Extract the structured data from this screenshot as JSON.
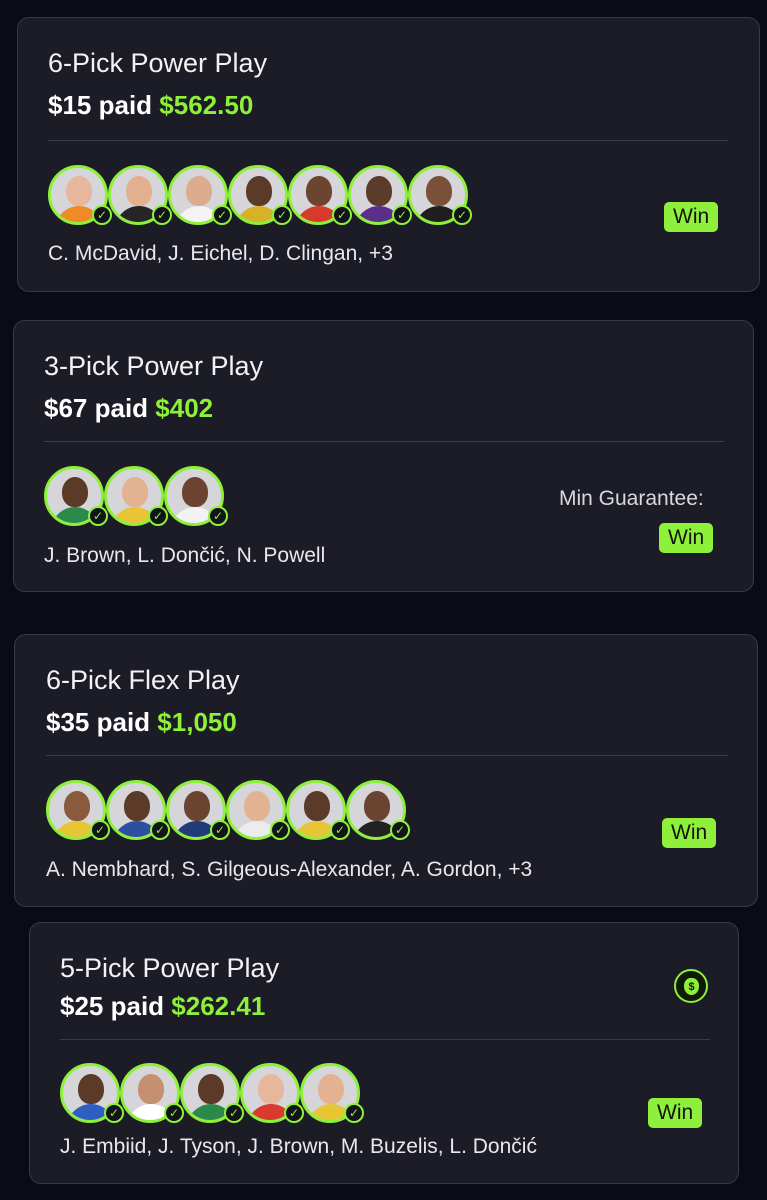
{
  "cards": [
    {
      "title": "6-Pick Power Play",
      "paid": "$15 paid",
      "payout": "$562.50",
      "names": "C. McDavid, J. Eichel, D. Clingan, +3",
      "status": "Win",
      "avatars": [
        {
          "skin": "#e7b79c",
          "shirt": "#f08a26"
        },
        {
          "skin": "#e3b08f",
          "shirt": "#262626"
        },
        {
          "skin": "#dcac8e",
          "shirt": "#f3f3f3"
        },
        {
          "skin": "#5a3a28",
          "shirt": "#d6b228"
        },
        {
          "skin": "#6b452f",
          "shirt": "#d63b2a"
        },
        {
          "skin": "#5b3b29",
          "shirt": "#5a2f8a"
        },
        {
          "skin": "#7a5038",
          "shirt": "#1f1f1f"
        }
      ]
    },
    {
      "title": "3-Pick Power Play",
      "paid": "$67 paid",
      "payout": "$402",
      "names": "J. Brown, L. Dončić, N. Powell",
      "guarantee_label": "Min Guarantee:",
      "status": "Win",
      "avatars": [
        {
          "skin": "#5b3a28",
          "shirt": "#2b8a4a"
        },
        {
          "skin": "#e2b292",
          "shirt": "#e8c534"
        },
        {
          "skin": "#6a4430",
          "shirt": "#f2f2f2"
        }
      ]
    },
    {
      "title": "6-Pick Flex Play",
      "paid": "$35 paid",
      "payout": "$1,050",
      "names": "A. Nembhard, S. Gilgeous-Alexander, A. Gordon, +3",
      "status": "Win",
      "avatars": [
        {
          "skin": "#8a5a3c",
          "shirt": "#e8c534"
        },
        {
          "skin": "#5b3a28",
          "shirt": "#2d4fa0"
        },
        {
          "skin": "#6b4430",
          "shirt": "#203a7a"
        },
        {
          "skin": "#e2b292",
          "shirt": "#ececec"
        },
        {
          "skin": "#5a3a28",
          "shirt": "#e8c534"
        },
        {
          "skin": "#6a4430",
          "shirt": "#222222"
        }
      ]
    },
    {
      "title": "5-Pick Power Play",
      "paid": "$25 paid",
      "payout": "$262.41",
      "names": "J. Embiid, J. Tyson, J. Brown, M. Buzelis, L. Dončić",
      "status": "Win",
      "top_icon": "money-bag-icon",
      "top_icon_glyph": "$",
      "avatars": [
        {
          "skin": "#5b3a28",
          "shirt": "#2f5ec2"
        },
        {
          "skin": "#c49070",
          "shirt": "#ffffff"
        },
        {
          "skin": "#5b3a28",
          "shirt": "#2b8a4a"
        },
        {
          "skin": "#e7b79c",
          "shirt": "#d83a2e"
        },
        {
          "skin": "#e2b292",
          "shirt": "#e8c534"
        }
      ]
    }
  ],
  "check_glyph": "✓",
  "colors": {
    "background": "#0b0b16",
    "card": "#1c1c26",
    "accent": "#8ef03a"
  }
}
